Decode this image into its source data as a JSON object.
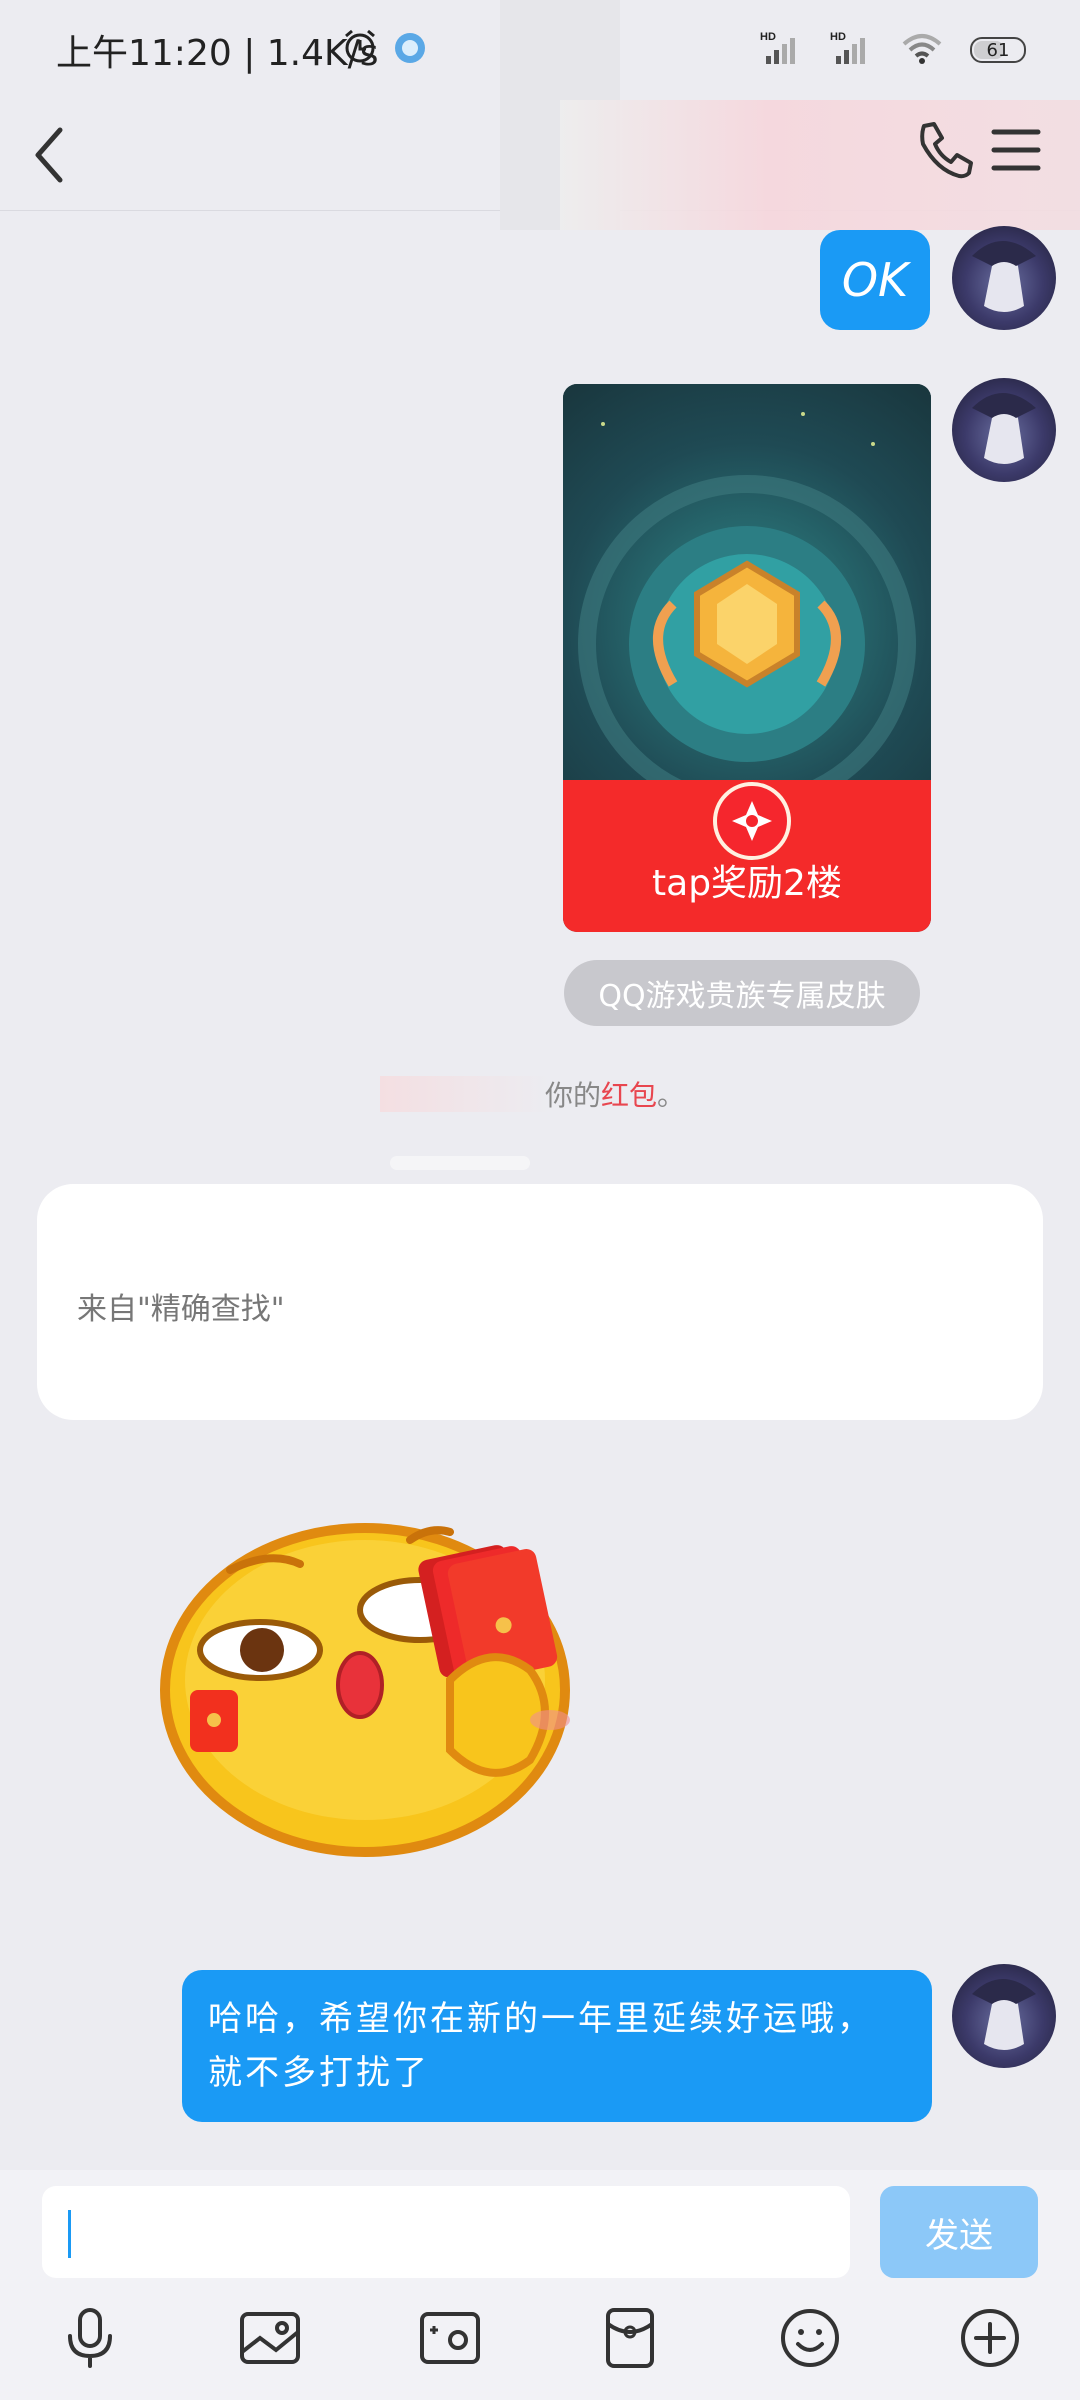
{
  "status_bar": {
    "time_speed": "上午11:20 | 1.4K/s",
    "signal1": "HD",
    "signal2": "HD",
    "battery": "61"
  },
  "chat": {
    "ok_message": "OK",
    "red_packet": {
      "label": "tap奖励2楼"
    },
    "skin_tag": "QQ游戏贵族专属皮肤",
    "system_message_prefix": "你的",
    "system_message_link": "红包",
    "system_message_suffix": "。",
    "source_card": "来自\"精确查找\"",
    "last_message": "哈哈，希望你在新的一年里延续好运哦，就不多打扰了"
  },
  "input": {
    "send_label": "发送"
  },
  "colors": {
    "bubble_blue": "#1a9af5",
    "send_disabled": "#8cc8f8",
    "red_packet": "#f42a2a",
    "link_red": "#e8464f"
  }
}
